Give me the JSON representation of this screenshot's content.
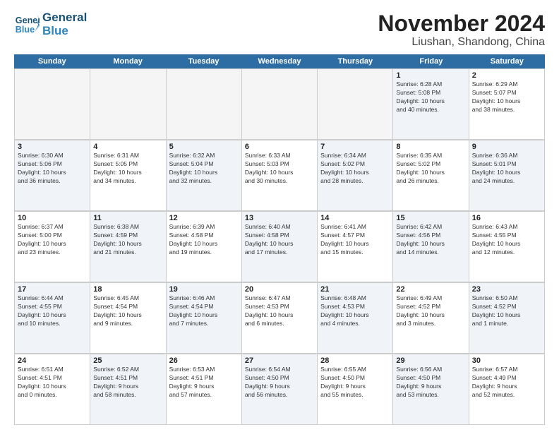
{
  "logo": {
    "line1": "General",
    "line2": "Blue"
  },
  "title": {
    "main": "November 2024",
    "sub": "Liushan, Shandong, China"
  },
  "weekdays": [
    "Sunday",
    "Monday",
    "Tuesday",
    "Wednesday",
    "Thursday",
    "Friday",
    "Saturday"
  ],
  "weeks": [
    [
      {
        "day": "",
        "info": "",
        "empty": true
      },
      {
        "day": "",
        "info": "",
        "empty": true
      },
      {
        "day": "",
        "info": "",
        "empty": true
      },
      {
        "day": "",
        "info": "",
        "empty": true
      },
      {
        "day": "",
        "info": "",
        "empty": true
      },
      {
        "day": "1",
        "info": "Sunrise: 6:28 AM\nSunset: 5:08 PM\nDaylight: 10 hours\nand 40 minutes.",
        "empty": false,
        "shade": true
      },
      {
        "day": "2",
        "info": "Sunrise: 6:29 AM\nSunset: 5:07 PM\nDaylight: 10 hours\nand 38 minutes.",
        "empty": false,
        "shade": false
      }
    ],
    [
      {
        "day": "3",
        "info": "Sunrise: 6:30 AM\nSunset: 5:06 PM\nDaylight: 10 hours\nand 36 minutes.",
        "empty": false,
        "shade": true
      },
      {
        "day": "4",
        "info": "Sunrise: 6:31 AM\nSunset: 5:05 PM\nDaylight: 10 hours\nand 34 minutes.",
        "empty": false,
        "shade": false
      },
      {
        "day": "5",
        "info": "Sunrise: 6:32 AM\nSunset: 5:04 PM\nDaylight: 10 hours\nand 32 minutes.",
        "empty": false,
        "shade": true
      },
      {
        "day": "6",
        "info": "Sunrise: 6:33 AM\nSunset: 5:03 PM\nDaylight: 10 hours\nand 30 minutes.",
        "empty": false,
        "shade": false
      },
      {
        "day": "7",
        "info": "Sunrise: 6:34 AM\nSunset: 5:02 PM\nDaylight: 10 hours\nand 28 minutes.",
        "empty": false,
        "shade": true
      },
      {
        "day": "8",
        "info": "Sunrise: 6:35 AM\nSunset: 5:02 PM\nDaylight: 10 hours\nand 26 minutes.",
        "empty": false,
        "shade": false
      },
      {
        "day": "9",
        "info": "Sunrise: 6:36 AM\nSunset: 5:01 PM\nDaylight: 10 hours\nand 24 minutes.",
        "empty": false,
        "shade": true
      }
    ],
    [
      {
        "day": "10",
        "info": "Sunrise: 6:37 AM\nSunset: 5:00 PM\nDaylight: 10 hours\nand 23 minutes.",
        "empty": false,
        "shade": false
      },
      {
        "day": "11",
        "info": "Sunrise: 6:38 AM\nSunset: 4:59 PM\nDaylight: 10 hours\nand 21 minutes.",
        "empty": false,
        "shade": true
      },
      {
        "day": "12",
        "info": "Sunrise: 6:39 AM\nSunset: 4:58 PM\nDaylight: 10 hours\nand 19 minutes.",
        "empty": false,
        "shade": false
      },
      {
        "day": "13",
        "info": "Sunrise: 6:40 AM\nSunset: 4:58 PM\nDaylight: 10 hours\nand 17 minutes.",
        "empty": false,
        "shade": true
      },
      {
        "day": "14",
        "info": "Sunrise: 6:41 AM\nSunset: 4:57 PM\nDaylight: 10 hours\nand 15 minutes.",
        "empty": false,
        "shade": false
      },
      {
        "day": "15",
        "info": "Sunrise: 6:42 AM\nSunset: 4:56 PM\nDaylight: 10 hours\nand 14 minutes.",
        "empty": false,
        "shade": true
      },
      {
        "day": "16",
        "info": "Sunrise: 6:43 AM\nSunset: 4:55 PM\nDaylight: 10 hours\nand 12 minutes.",
        "empty": false,
        "shade": false
      }
    ],
    [
      {
        "day": "17",
        "info": "Sunrise: 6:44 AM\nSunset: 4:55 PM\nDaylight: 10 hours\nand 10 minutes.",
        "empty": false,
        "shade": true
      },
      {
        "day": "18",
        "info": "Sunrise: 6:45 AM\nSunset: 4:54 PM\nDaylight: 10 hours\nand 9 minutes.",
        "empty": false,
        "shade": false
      },
      {
        "day": "19",
        "info": "Sunrise: 6:46 AM\nSunset: 4:54 PM\nDaylight: 10 hours\nand 7 minutes.",
        "empty": false,
        "shade": true
      },
      {
        "day": "20",
        "info": "Sunrise: 6:47 AM\nSunset: 4:53 PM\nDaylight: 10 hours\nand 6 minutes.",
        "empty": false,
        "shade": false
      },
      {
        "day": "21",
        "info": "Sunrise: 6:48 AM\nSunset: 4:53 PM\nDaylight: 10 hours\nand 4 minutes.",
        "empty": false,
        "shade": true
      },
      {
        "day": "22",
        "info": "Sunrise: 6:49 AM\nSunset: 4:52 PM\nDaylight: 10 hours\nand 3 minutes.",
        "empty": false,
        "shade": false
      },
      {
        "day": "23",
        "info": "Sunrise: 6:50 AM\nSunset: 4:52 PM\nDaylight: 10 hours\nand 1 minute.",
        "empty": false,
        "shade": true
      }
    ],
    [
      {
        "day": "24",
        "info": "Sunrise: 6:51 AM\nSunset: 4:51 PM\nDaylight: 10 hours\nand 0 minutes.",
        "empty": false,
        "shade": false
      },
      {
        "day": "25",
        "info": "Sunrise: 6:52 AM\nSunset: 4:51 PM\nDaylight: 9 hours\nand 58 minutes.",
        "empty": false,
        "shade": true
      },
      {
        "day": "26",
        "info": "Sunrise: 6:53 AM\nSunset: 4:51 PM\nDaylight: 9 hours\nand 57 minutes.",
        "empty": false,
        "shade": false
      },
      {
        "day": "27",
        "info": "Sunrise: 6:54 AM\nSunset: 4:50 PM\nDaylight: 9 hours\nand 56 minutes.",
        "empty": false,
        "shade": true
      },
      {
        "day": "28",
        "info": "Sunrise: 6:55 AM\nSunset: 4:50 PM\nDaylight: 9 hours\nand 55 minutes.",
        "empty": false,
        "shade": false
      },
      {
        "day": "29",
        "info": "Sunrise: 6:56 AM\nSunset: 4:50 PM\nDaylight: 9 hours\nand 53 minutes.",
        "empty": false,
        "shade": true
      },
      {
        "day": "30",
        "info": "Sunrise: 6:57 AM\nSunset: 4:49 PM\nDaylight: 9 hours\nand 52 minutes.",
        "empty": false,
        "shade": false
      }
    ]
  ]
}
